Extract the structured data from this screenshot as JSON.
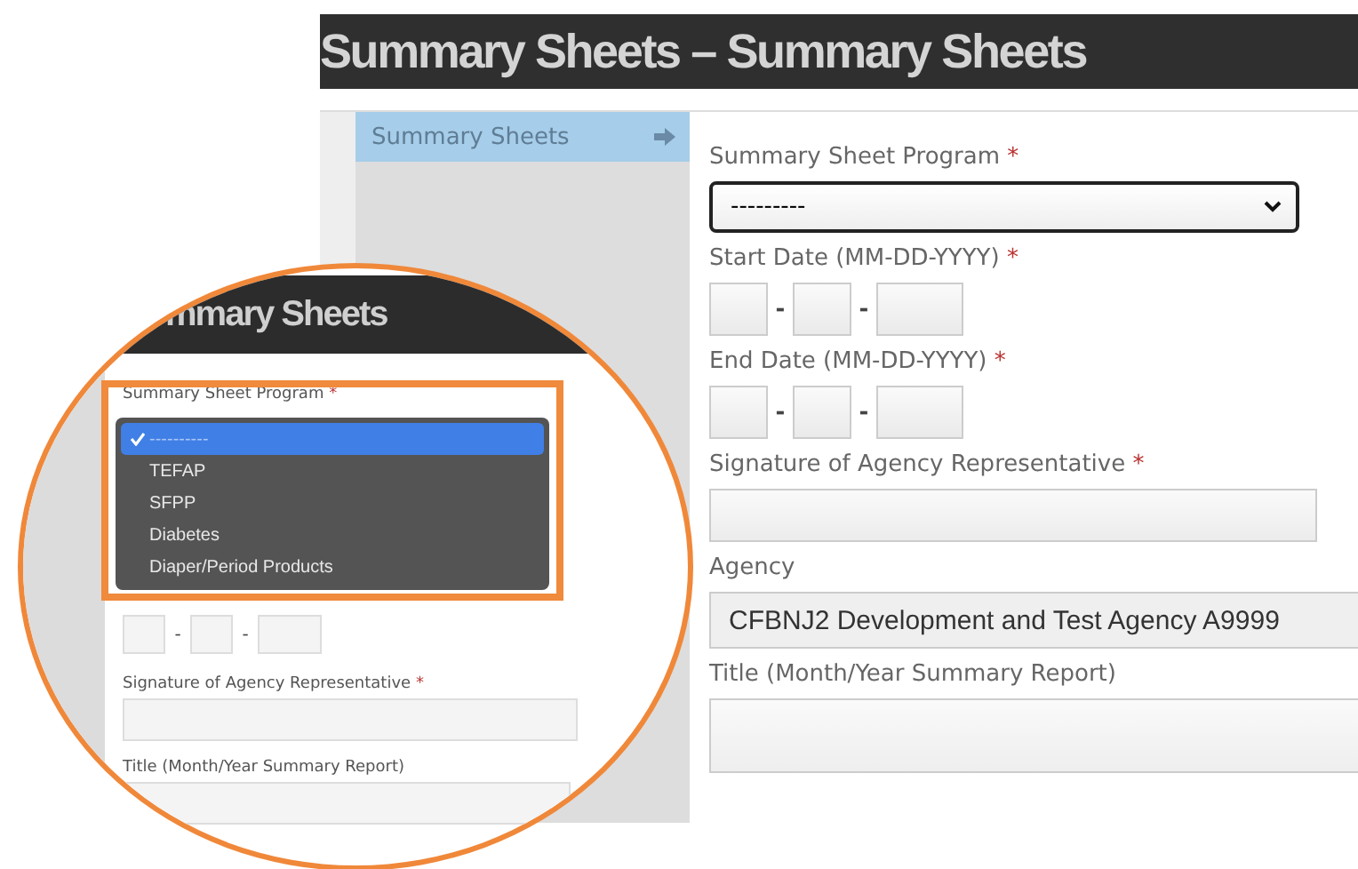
{
  "header": {
    "title": "Summary Sheets – Summary Sheets"
  },
  "sidebar": {
    "items": [
      {
        "label": "Summary Sheets",
        "selected": true
      }
    ]
  },
  "form": {
    "fields": [
      {
        "kind": "select",
        "label": "Summary Sheet Program",
        "mark": "*",
        "value": "---------"
      },
      {
        "kind": "date",
        "label": "Start Date (MM-DD-YYYY)",
        "mark": "*",
        "separators": [
          "-",
          "-"
        ]
      },
      {
        "kind": "date",
        "label": "End Date (MM-DD-YYYY)",
        "mark": "*",
        "separators": [
          "-",
          "-"
        ]
      },
      {
        "kind": "text",
        "label": "Signature of Agency Representative",
        "mark": "*"
      },
      {
        "kind": "readonly",
        "label": "Agency",
        "value": "CFBNJ2 Development and Test Agency A9999"
      },
      {
        "kind": "textarea",
        "label": "Title (Month/Year Summary Report)"
      }
    ]
  },
  "inset": {
    "title": "mmary Sheets",
    "field_label": "Summary Sheet Program",
    "mark": "*",
    "options": [
      {
        "label": "----------",
        "selected": true
      },
      {
        "label": "TEFAP",
        "selected": false
      },
      {
        "label": "SFPP",
        "selected": false
      },
      {
        "label": "Diabetes",
        "selected": false
      },
      {
        "label": "Diaper/Period Products",
        "selected": false
      }
    ],
    "date_separators": [
      "-",
      "-"
    ],
    "signature_label": "Signature of Agency Representative",
    "signature_mark": "*",
    "title_label": "Title (Month/Year Summary Report)"
  }
}
